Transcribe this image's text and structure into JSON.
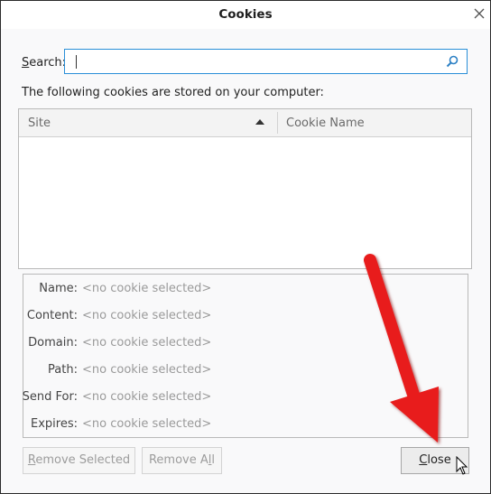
{
  "window": {
    "title": "Cookies"
  },
  "search": {
    "label_prefix": "",
    "label_accel": "S",
    "label_rest": "earch:",
    "value": "",
    "placeholder": ""
  },
  "intro_text": "The following cookies are stored on your computer:",
  "tree": {
    "columns": [
      "Site",
      "Cookie Name"
    ],
    "rows": []
  },
  "details": [
    {
      "label": "Name:",
      "value": "<no cookie selected>"
    },
    {
      "label": "Content:",
      "value": "<no cookie selected>"
    },
    {
      "label": "Domain:",
      "value": "<no cookie selected>"
    },
    {
      "label": "Path:",
      "value": "<no cookie selected>"
    },
    {
      "label": "Send For:",
      "value": "<no cookie selected>"
    },
    {
      "label": "Expires:",
      "value": "<no cookie selected>"
    }
  ],
  "buttons": {
    "remove_selected": {
      "accel": "R",
      "rest": "emove Selected"
    },
    "remove_all": {
      "pre": "Remove A",
      "accel": "l",
      "post": "l"
    },
    "close": {
      "accel": "C",
      "rest": "lose"
    }
  },
  "colors": {
    "annotation_arrow": "#e81e1e",
    "search_focus_border": "#2a8fd8"
  },
  "icons": {
    "window_close": "close-icon",
    "search": "search-icon",
    "sort": "sort-ascending-icon",
    "pointer": "mouse-pointer-icon"
  }
}
